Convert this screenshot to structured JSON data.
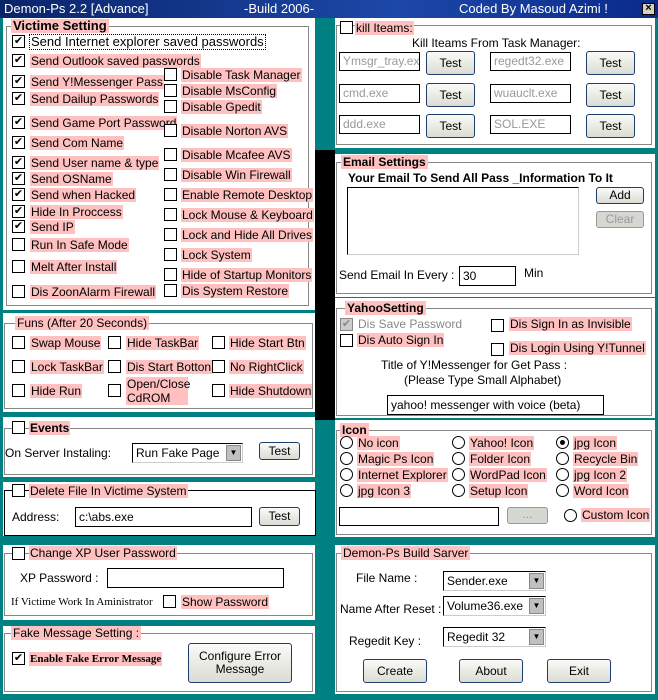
{
  "window": {
    "title_left": "Demon-Ps 2.2  [Advance]",
    "title_mid": "-Build 2006-",
    "title_right": "Coded By Masoud Azimi !",
    "close": "x"
  },
  "victime": {
    "legend": "Victime Setting",
    "left": [
      {
        "label": "Send Internet explorer saved passwords",
        "checked": true
      },
      {
        "label": "Send Outlook saved passwords",
        "checked": true
      },
      {
        "label": "Send Y!Messenger Pass",
        "checked": true
      },
      {
        "label": "Send Dailup Passwords",
        "checked": true
      },
      {
        "label": "Send Game Port Password",
        "checked": true
      },
      {
        "label": "Send Com Name",
        "checked": true
      },
      {
        "label": "Send User name & type",
        "checked": true
      },
      {
        "label": "Send OSName",
        "checked": true
      },
      {
        "label": "Send when Hacked",
        "checked": true
      },
      {
        "label": "Hide In Proccess",
        "checked": true
      },
      {
        "label": "Send IP",
        "checked": true
      },
      {
        "label": "Run In Safe Mode",
        "checked": false
      },
      {
        "label": "Melt After Install",
        "checked": false
      },
      {
        "label": "Dis ZoonAlarm Firewall",
        "checked": false
      }
    ],
    "right": [
      {
        "label": "Disable Task Manager",
        "checked": false
      },
      {
        "label": "Disable MsConfig",
        "checked": false
      },
      {
        "label": "Disable Gpedit",
        "checked": false
      },
      {
        "label": "Disable Norton AVS",
        "checked": false
      },
      {
        "label": "Disable Mcafee AVS",
        "checked": false
      },
      {
        "label": "Disable Win Firewall",
        "checked": false
      },
      {
        "label": "Enable Remote Desktop",
        "checked": false
      },
      {
        "label": "Lock Mouse & Keyboard",
        "checked": false
      },
      {
        "label": "Lock and Hide All Drives",
        "checked": false
      },
      {
        "label": "Lock System",
        "checked": false
      },
      {
        "label": "Hide of Startup Monitors",
        "checked": false
      },
      {
        "label": "Dis System Restore",
        "checked": false
      }
    ]
  },
  "funs": {
    "legend": "Funs (After 20 Seconds)",
    "items": [
      "Swap Mouse",
      "Hide TaskBar",
      "Hide Start Btn",
      "Lock TaskBar",
      "Dis Start Botton",
      "No RightClick",
      "Hide Run",
      "Open/Close CdROM",
      "Hide Shutdown"
    ]
  },
  "events": {
    "legend": "Events",
    "label": "On Server Instaling:",
    "select": "Run Fake Page",
    "test": "Test"
  },
  "delete": {
    "legend": "Delete File In Victime System",
    "address_label": "Address:",
    "address": "c:\\abs.exe",
    "test": "Test"
  },
  "xp": {
    "legend": "Change XP User Password",
    "password_label": "XP Password :",
    "password": "",
    "admin_label": "If Victime Work In Aministrator",
    "show": "Show Password"
  },
  "fake": {
    "legend": "Fake Message Setting :",
    "enable": "Enable Fake Error Message",
    "configure": "Configure Error Message"
  },
  "kill": {
    "legend": "kill Iteams:",
    "subtitle": "Kill Iteams From Task Manager:",
    "items": [
      "Ymsgr_tray.exe",
      "regedt32.exe",
      "cmd.exe",
      "wuauclt.exe",
      "ddd.exe",
      "SOL.EXE"
    ],
    "test": "Test"
  },
  "email": {
    "legend": "Email Settings",
    "heading": "Your Email To Send All Pass _Information To It",
    "add": "Add",
    "clear": "Clear",
    "every_label": "Send Email In Every :",
    "every": "30",
    "unit": "Min"
  },
  "yahoo": {
    "legend": "YahooSetting",
    "dis_save": "Dis Save Password",
    "dis_auto": "Dis Auto Sign In",
    "dis_invisible": "Dis Sign In as Invisible",
    "dis_tunnel": "Dis Login Using Y!Tunnel",
    "title_label": "Title of Y!Messenger for Get Pass  :",
    "title_hint": "(Please Type Small Alphabet)",
    "title_value": "yahoo! messenger with voice (beta)"
  },
  "icon": {
    "legend": "Icon",
    "options": [
      "No icon",
      "Yahoo! Icon",
      "jpg Icon",
      "Magic Ps Icon",
      "Folder Icon",
      "Recycle Bin",
      "Internet Explorer",
      "WordPad Icon",
      "jpg Icon 2",
      "jpg Icon 3",
      "Setup Icon",
      "Word Icon"
    ],
    "selected": "jpg Icon",
    "path": "",
    "browse": "...",
    "custom": "Custom Icon"
  },
  "build": {
    "legend": "Demon-Ps Build Sarver",
    "file_label": "File Name :",
    "file": "Sender.exe",
    "reset_label": "Name After Reset :",
    "reset": "Volume36.exe",
    "reg_label": "Regedit Key :",
    "reg": "Regedit 32",
    "create": "Create",
    "about": "About",
    "exit": "Exit"
  },
  "colors": {
    "label_highlight": "#ffc0c0",
    "background": "#008080",
    "titlebar": "#0a246a"
  }
}
